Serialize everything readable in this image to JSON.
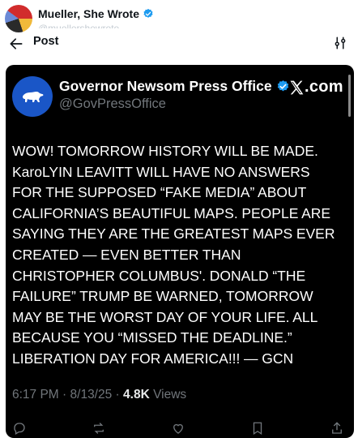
{
  "account": {
    "name": "Mueller, She Wrote",
    "handle": "@muellershewrote"
  },
  "header": {
    "title": "Post",
    "back_icon": "arrow-left-icon",
    "settings_icon": "sliders-icon"
  },
  "tweet": {
    "author_name": "Governor Newsom Press Office",
    "author_handle": "@GovPressOffice",
    "platform_logo": ".com",
    "lines": [
      "WOW! TOMORROW HISTORY WILL BE MADE.",
      "KaroLYIN LEAVITT WILL HAVE NO ANSWERS",
      "FOR THE SUPPOSED “FAKE MEDIA” ABOUT",
      "CALIFORNIA’S BEAUTIFUL MAPS. PEOPLE ARE",
      "SAYING THEY ARE THE GREATEST MAPS EVER",
      "CREATED — EVEN BETTER THAN",
      "CHRISTOPHER COLUMBUS'. DONALD “THE",
      "FAILURE” TRUMP BE WARNED, TOMORROW",
      "MAY BE THE WORST DAY OF YOUR LIFE. ALL",
      "BECAUSE YOU “MISSED THE DEADLINE.”",
      "LIBERATION DAY FOR AMERICA!!! — GCN"
    ],
    "time": "6:17 PM",
    "date": "8/13/25",
    "views_count": "4.8K",
    "views_label": "Views"
  },
  "colors": {
    "card_bg": "#000000",
    "verified_blue": "#1d9bf0",
    "avatar_blue": "#1a56c7"
  }
}
